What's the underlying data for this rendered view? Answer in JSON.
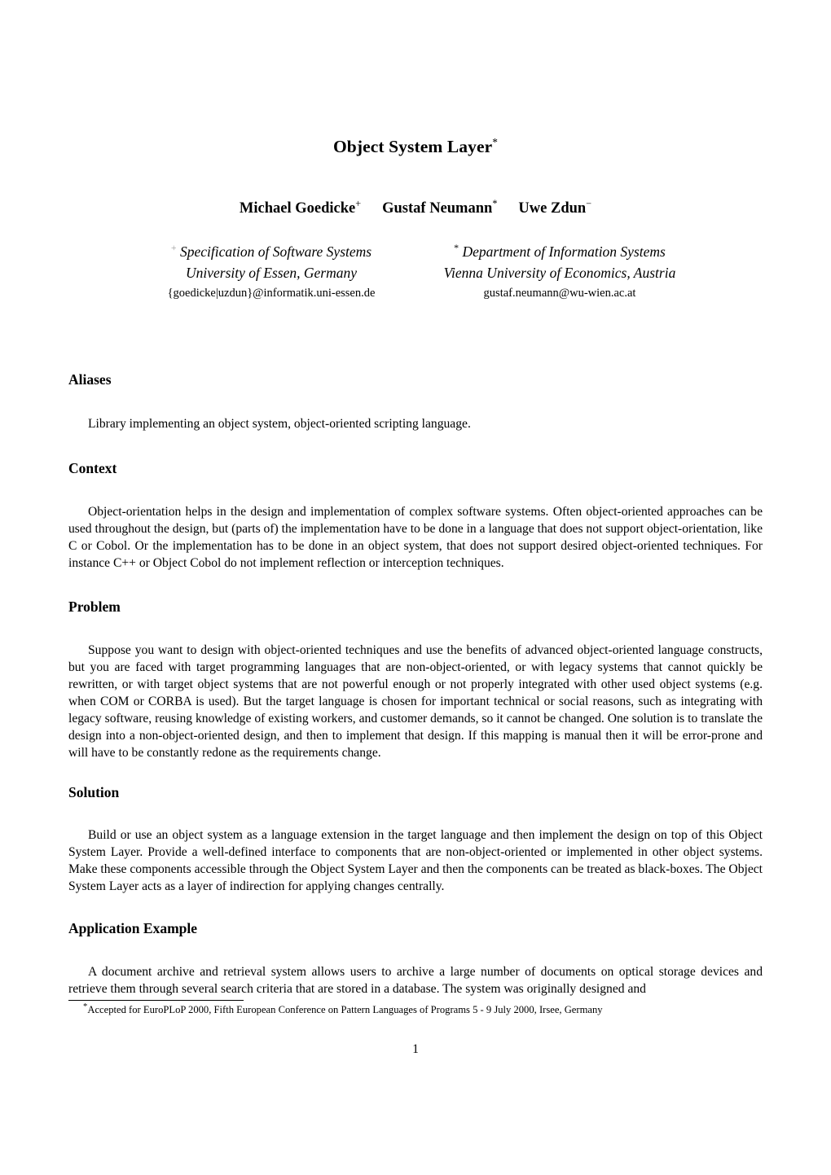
{
  "paper": {
    "title": "Object System Layer",
    "title_footnote_mark": "*",
    "authors": [
      {
        "name": "Michael Goedicke",
        "mark": "+"
      },
      {
        "name": "Gustaf Neumann",
        "mark": "*"
      },
      {
        "name": "Uwe Zdun",
        "mark": "−"
      }
    ],
    "affiliations": [
      {
        "mark": "+",
        "institute": "Specification of Software Systems",
        "university": "University of Essen, Germany",
        "email": "{goedicke|uzdun}@informatik.uni-essen.de"
      },
      {
        "mark": "*",
        "institute": "Department of Information Systems",
        "university": "Vienna University of Economics, Austria",
        "email": "gustaf.neumann@wu-wien.ac.at"
      }
    ],
    "sections": [
      {
        "heading": "Aliases",
        "body": "Library implementing an object system, object-oriented scripting language."
      },
      {
        "heading": "Context",
        "body": "Object-orientation helps in the design and implementation of complex software systems. Often object-oriented approaches can be used throughout the design, but (parts of) the implementation have to be done in a language that does not support object-orientation, like C or Cobol. Or the implementation has to be done in an object system, that does not support desired object-oriented techniques. For instance C++ or Object Cobol do not implement reflection or interception techniques."
      },
      {
        "heading": "Problem",
        "body": "Suppose you want to design with object-oriented techniques and use the benefits of advanced object-oriented language constructs, but you are faced with target programming languages that are non-object-oriented, or with legacy systems that cannot quickly be rewritten, or with target object systems that are not powerful enough or not properly integrated with other used object systems (e.g. when COM or CORBA is used). But the target language is chosen for important technical or social reasons, such as integrating with legacy software, reusing knowledge of existing workers, and customer demands, so it cannot be changed. One solution is to translate the design into a non-object-oriented design, and then to implement that design. If this mapping is manual then it will be error-prone and will have to be constantly redone as the requirements change."
      },
      {
        "heading": "Solution",
        "body": "Build or use an object system as a language extension in the target language and then implement the design on top of this Object System Layer. Provide a well-defined interface to components that are non-object-oriented or implemented in other object systems. Make these components accessible through the Object System Layer and then the components can be treated as black-boxes. The Object System Layer acts as a layer of indirection for applying changes centrally."
      },
      {
        "heading": "Application Example",
        "body": "A document archive and retrieval system allows users to archive a large number of documents on optical storage devices and retrieve them through several search criteria that are stored in a database. The system was originally designed and"
      }
    ],
    "footnote": {
      "mark": "*",
      "text": "Accepted for EuroPLoP 2000, Fifth European Conference on Pattern Languages of Programs 5 - 9 July 2000, Irsee, Germany"
    },
    "page_number": "1"
  }
}
